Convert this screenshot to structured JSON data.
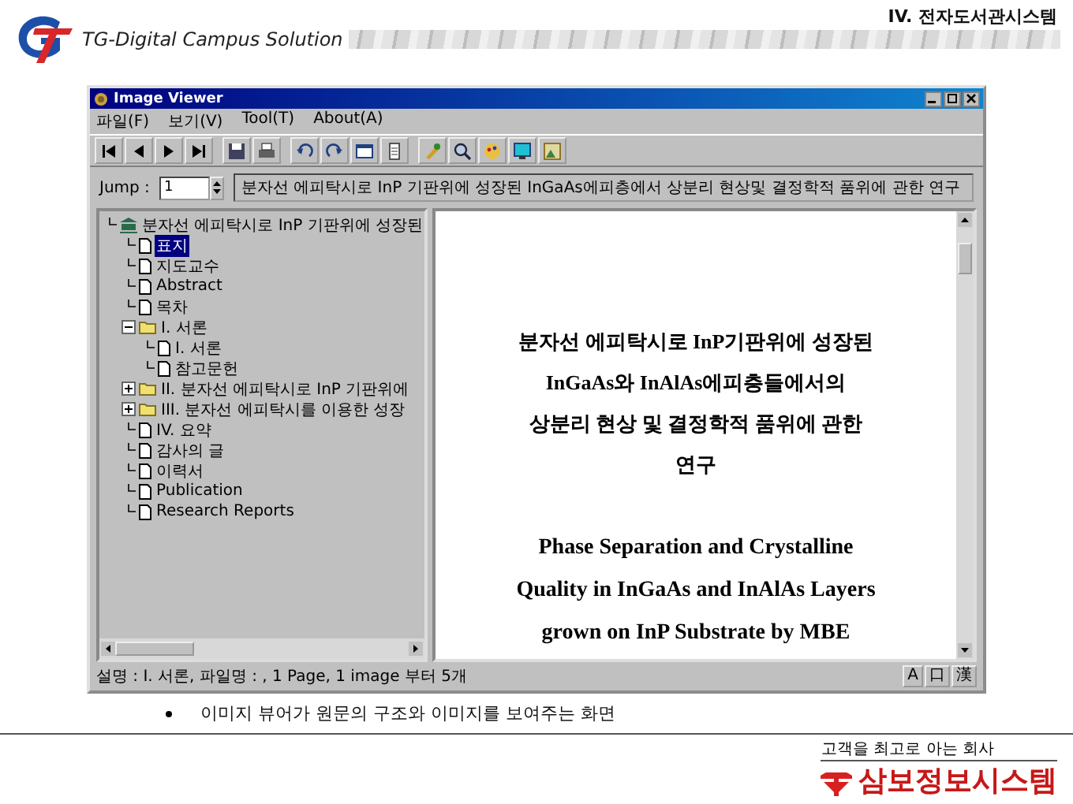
{
  "slide": {
    "brand": "TG-Digital Campus Solution",
    "section": "IV. 전자도서관시스템",
    "caption": "이미지 뷰어가 원문의 구조와 이미지를 보여주는 화면",
    "footer_slogan": "고객을 최고로 아는 회사",
    "footer_company": "삼보정보시스템"
  },
  "window": {
    "title": "Image Viewer"
  },
  "menu": [
    "파일(F)",
    "보기(V)",
    "Tool(T)",
    "About(A)"
  ],
  "toolbar": [
    {
      "kind": "first"
    },
    {
      "kind": "prev"
    },
    {
      "kind": "next"
    },
    {
      "kind": "last"
    },
    {
      "kind": "save"
    },
    {
      "kind": "print"
    },
    {
      "kind": "undo"
    },
    {
      "kind": "redo"
    },
    {
      "kind": "fit"
    },
    {
      "kind": "page"
    },
    {
      "kind": "tool"
    },
    {
      "kind": "find"
    },
    {
      "kind": "color"
    },
    {
      "kind": "screen"
    },
    {
      "kind": "image"
    }
  ],
  "jump": {
    "label": "Jump :",
    "value": "1",
    "title": "분자선 에피탁시로 InP 기판위에 성장된 InGaAs에피층에서 상분리 현상및 결정학적 품위에 관한 연구"
  },
  "tree": [
    {
      "kind": "book",
      "label": "분자선 에피탁시로 InP 기판위에 성장된",
      "selected": false,
      "children": [
        {
          "kind": "page",
          "label": "표지",
          "selected": true
        },
        {
          "kind": "page",
          "label": "지도교수",
          "selected": false
        },
        {
          "kind": "page",
          "label": "Abstract",
          "selected": false
        },
        {
          "kind": "page",
          "label": "목차",
          "selected": false
        },
        {
          "kind": "folder",
          "label": "I. 서론",
          "selected": false,
          "expanded": true,
          "children": [
            {
              "kind": "page",
              "label": "I. 서론",
              "selected": false
            },
            {
              "kind": "page",
              "label": "참고문헌",
              "selected": false
            }
          ]
        },
        {
          "kind": "folder",
          "label": "II. 분자선 에피탁시로 InP 기판위에",
          "selected": false,
          "expanded": false
        },
        {
          "kind": "folder",
          "label": "III. 분자선 에피탁시를 이용한 성장",
          "selected": false,
          "expanded": false
        },
        {
          "kind": "page",
          "label": "IV. 요약",
          "selected": false
        },
        {
          "kind": "page",
          "label": "감사의 글",
          "selected": false
        },
        {
          "kind": "page",
          "label": "이력서",
          "selected": false
        },
        {
          "kind": "page",
          "label": "Publication",
          "selected": false
        },
        {
          "kind": "page",
          "label": "Research Reports",
          "selected": false
        }
      ]
    }
  ],
  "document": {
    "korean_title": [
      "분자선 에피탁시로 InP기판위에 성장된",
      "InGaAs와 InAlAs에피층들에서의",
      "상분리 현상 및 결정학적 품위에 관한",
      "연구"
    ],
    "english_title": [
      "Phase Separation and Crystalline",
      "Quality in InGaAs and InAlAs Layers",
      "grown on InP Substrate by MBE"
    ]
  },
  "status_bar": {
    "text": "설명 : I. 서론, 파일명 : , 1 Page, 1 image 부터 5개",
    "buttons": [
      "A",
      "口",
      "漢"
    ]
  }
}
